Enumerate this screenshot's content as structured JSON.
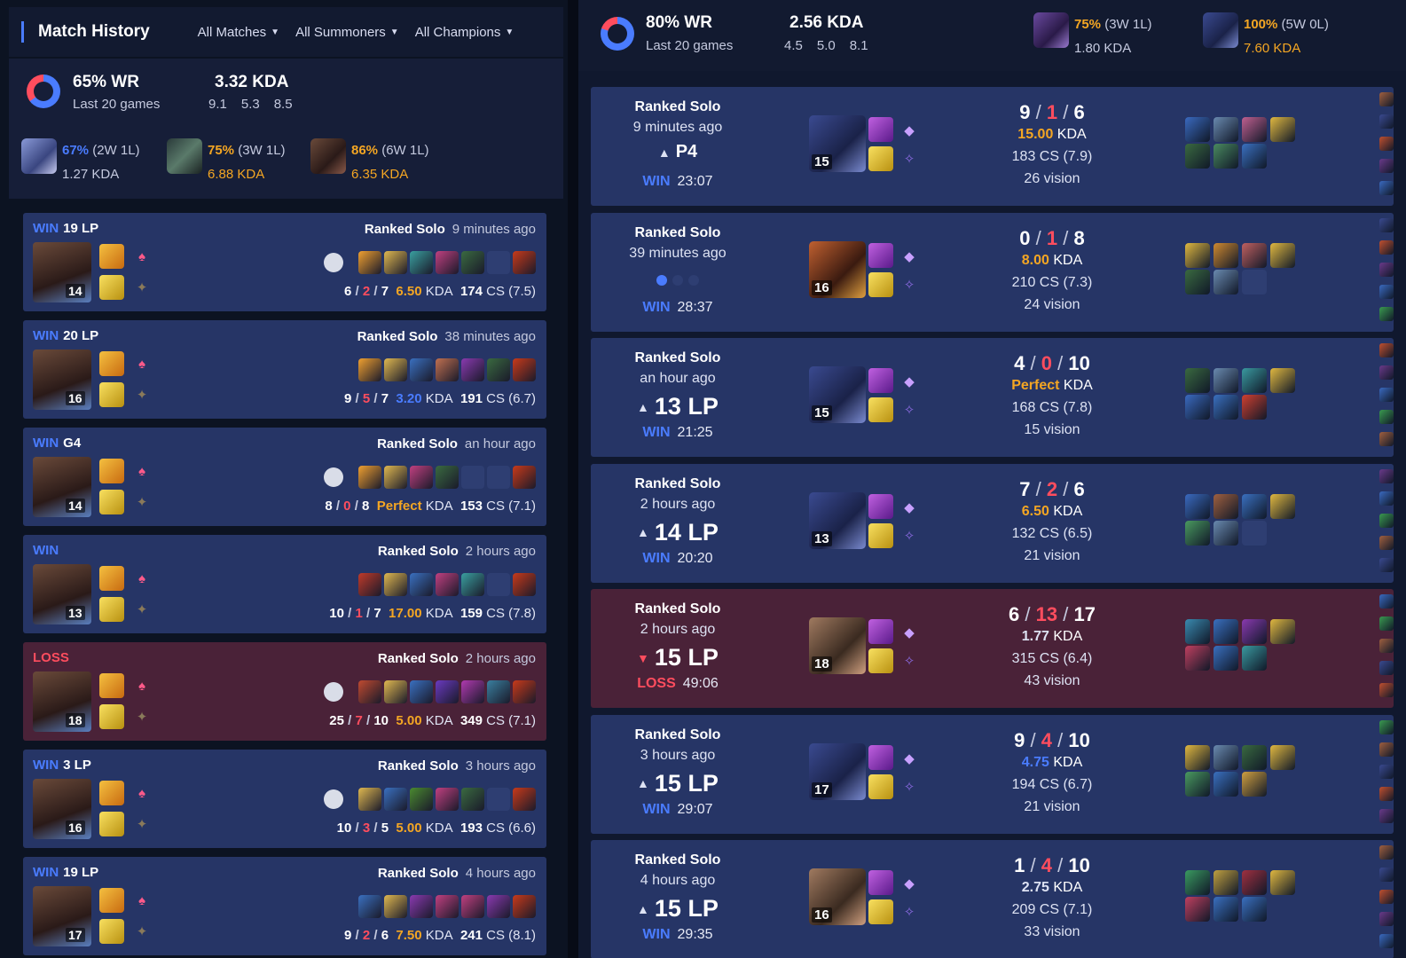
{
  "left": {
    "title": "Match History",
    "filters": [
      "All Matches",
      "All Summoners",
      "All Champions"
    ],
    "summary": {
      "wr": "65% WR",
      "sub": "Last 20 games",
      "kda": "3.32 KDA",
      "kda_parts": [
        "9.1",
        "5.3",
        "8.5"
      ],
      "winrate": 0.65
    },
    "champ_stats": [
      {
        "pct": "67%",
        "rec": "(2W 1L)",
        "kda": "1.27 KDA",
        "pct_color": "#4a7cff",
        "kda_color": "#c4c9de"
      },
      {
        "pct": "75%",
        "rec": "(3W 1L)",
        "kda": "6.88 KDA",
        "pct_color": "#f4a623",
        "kda_color": "#f4a623"
      },
      {
        "pct": "86%",
        "rec": "(6W 1L)",
        "kda": "6.35 KDA",
        "pct_color": "#f4a623",
        "kda_color": "#f4a623"
      }
    ],
    "matches": [
      {
        "result": "WIN",
        "lp": "19 LP",
        "queue": "Ranked Solo",
        "time": "9 minutes ago",
        "level": "14",
        "k": "6",
        "d": "2",
        "a": "7",
        "kda": "6.50",
        "kda_color": "#f4a623",
        "cs": "174",
        "csm": "CS (7.5)",
        "ward": true
      },
      {
        "result": "WIN",
        "lp": "20 LP",
        "queue": "Ranked Solo",
        "time": "38 minutes ago",
        "level": "16",
        "k": "9",
        "d": "5",
        "a": "7",
        "kda": "3.20",
        "kda_color": "#4a7cff",
        "cs": "191",
        "csm": "CS (6.7)",
        "ward": false
      },
      {
        "result": "WIN",
        "lp": "G4",
        "queue": "Ranked Solo",
        "time": "an hour ago",
        "level": "14",
        "k": "8",
        "d": "0",
        "a": "8",
        "kda": "Perfect",
        "kda_color": "#f4a623",
        "cs": "153",
        "csm": "CS (7.1)",
        "ward": true
      },
      {
        "result": "WIN",
        "lp": "",
        "queue": "Ranked Solo",
        "time": "2 hours ago",
        "level": "13",
        "k": "10",
        "d": "1",
        "a": "7",
        "kda": "17.00",
        "kda_color": "#f4a623",
        "cs": "159",
        "csm": "CS (7.8)",
        "ward": false
      },
      {
        "result": "LOSS",
        "lp": "",
        "queue": "Ranked Solo",
        "time": "2 hours ago",
        "level": "18",
        "k": "25",
        "d": "7",
        "a": "10",
        "kda": "5.00",
        "kda_color": "#f4a623",
        "cs": "349",
        "csm": "CS (7.1)",
        "ward": true
      },
      {
        "result": "WIN",
        "lp": "3 LP",
        "queue": "Ranked Solo",
        "time": "3 hours ago",
        "level": "16",
        "k": "10",
        "d": "3",
        "a": "5",
        "kda": "5.00",
        "kda_color": "#f4a623",
        "cs": "193",
        "csm": "CS (6.6)",
        "ward": true
      },
      {
        "result": "WIN",
        "lp": "19 LP",
        "queue": "Ranked Solo",
        "time": "4 hours ago",
        "level": "17",
        "k": "9",
        "d": "2",
        "a": "6",
        "kda": "7.50",
        "kda_color": "#f4a623",
        "cs": "241",
        "csm": "CS (8.1)",
        "ward": false
      }
    ]
  },
  "right": {
    "summary": {
      "wr": "80% WR",
      "sub": "Last 20 games",
      "kda": "2.56 KDA",
      "kda_parts": [
        "4.5",
        "5.0",
        "8.1"
      ],
      "winrate": 0.8
    },
    "champ_stats": [
      {
        "pct": "75%",
        "rec": "(3W 1L)",
        "kda": "1.80 KDA",
        "pct_color": "#f4a623",
        "kda_color": "#c4c9de"
      },
      {
        "pct": "100%",
        "rec": "(5W 0L)",
        "kda": "7.60 KDA",
        "pct_color": "#f4a623",
        "kda_color": "#f4a623"
      }
    ],
    "matches": [
      {
        "queue": "Ranked Solo",
        "time": "9 minutes ago",
        "rank": "P4",
        "result": "WIN",
        "duration": "23:07",
        "level": "15",
        "k": "9",
        "d": "1",
        "a": "6",
        "kda": "15.00",
        "kda_color": "#f4a623",
        "cs": "183 CS (7.9)",
        "vision": "26 vision",
        "loss": false
      },
      {
        "queue": "Ranked Solo",
        "time": "39 minutes ago",
        "rank": "",
        "result": "WIN",
        "duration": "28:37",
        "level": "16",
        "k": "0",
        "d": "1",
        "a": "8",
        "kda": "8.00",
        "kda_color": "#f4a623",
        "cs": "210 CS (7.3)",
        "vision": "24 vision",
        "loss": false
      },
      {
        "queue": "Ranked Solo",
        "time": "an hour ago",
        "rank": "13 LP",
        "result": "WIN",
        "duration": "21:25",
        "level": "15",
        "k": "4",
        "d": "0",
        "a": "10",
        "kda": "Perfect",
        "kda_color": "#f4a623",
        "cs": "168 CS (7.8)",
        "vision": "15 vision",
        "loss": false
      },
      {
        "queue": "Ranked Solo",
        "time": "2 hours ago",
        "rank": "14 LP",
        "result": "WIN",
        "duration": "20:20",
        "level": "13",
        "k": "7",
        "d": "2",
        "a": "6",
        "kda": "6.50",
        "kda_color": "#f4a623",
        "cs": "132 CS (6.5)",
        "vision": "21 vision",
        "loss": false
      },
      {
        "queue": "Ranked Solo",
        "time": "2 hours ago",
        "rank": "15 LP",
        "result": "LOSS",
        "duration": "49:06",
        "level": "18",
        "k": "6",
        "d": "13",
        "a": "17",
        "kda": "1.77",
        "kda_color": "#dde2f3",
        "cs": "315 CS (6.4)",
        "vision": "43 vision",
        "loss": true
      },
      {
        "queue": "Ranked Solo",
        "time": "3 hours ago",
        "rank": "15 LP",
        "result": "WIN",
        "duration": "29:07",
        "level": "17",
        "k": "9",
        "d": "4",
        "a": "10",
        "kda": "4.75",
        "kda_color": "#4a7cff",
        "cs": "194 CS (6.7)",
        "vision": "21 vision",
        "loss": false
      },
      {
        "queue": "Ranked Solo",
        "time": "4 hours ago",
        "rank": "15 LP",
        "result": "WIN",
        "duration": "29:35",
        "level": "16",
        "k": "1",
        "d": "4",
        "a": "10",
        "kda": "2.75",
        "kda_color": "#dde2f3",
        "cs": "209 CS (7.1)",
        "vision": "33 vision",
        "loss": false
      }
    ]
  },
  "kda_word": "KDA",
  "colors": {
    "win": "#4a7cff",
    "loss": "#ff4d5e",
    "accent_gold": "#f4a623"
  }
}
